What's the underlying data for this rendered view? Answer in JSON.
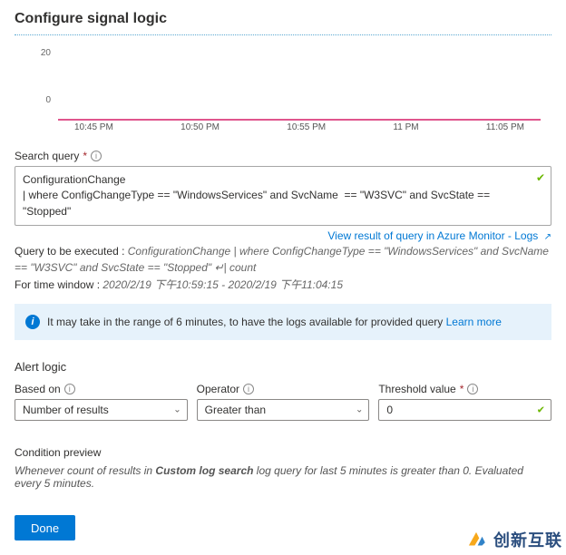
{
  "page": {
    "title": "Configure signal logic"
  },
  "chart_data": {
    "type": "line",
    "x": [
      "10:45 PM",
      "10:50 PM",
      "10:55 PM",
      "11 PM",
      "11:05 PM"
    ],
    "values": [
      0,
      0,
      0,
      0,
      0
    ],
    "y_ticks": [
      0,
      20
    ],
    "ylim": [
      0,
      20
    ],
    "title": "",
    "xlabel": "",
    "ylabel": ""
  },
  "search_query": {
    "label": "Search query",
    "required": true,
    "text": "ConfigurationChange\n| where ConfigChangeType == \"WindowsServices\" and SvcName  == \"W3SVC\" and SvcState == \"Stopped\"",
    "link_text": "View result of query in Azure Monitor - Logs",
    "exec_prefix": "Query to be executed : ",
    "exec_query": "ConfigurationChange | where ConfigChangeType == \"WindowsServices\" and SvcName == \"W3SVC\" and SvcState == \"Stopped\" ↵| count",
    "time_window_prefix": "For time window : ",
    "time_window": "2020/2/19 下午10:59:15 - 2020/2/19 下午11:04:15"
  },
  "info_banner": {
    "text": "It may take in the range of 6 minutes, to have the logs available for provided query",
    "link": "Learn more"
  },
  "alert_logic": {
    "heading": "Alert logic",
    "based_on": {
      "label": "Based on",
      "value": "Number of results"
    },
    "operator": {
      "label": "Operator",
      "value": "Greater than"
    },
    "threshold": {
      "label": "Threshold value",
      "required": true,
      "value": "0"
    }
  },
  "condition": {
    "heading": "Condition preview",
    "prefix": "Whenever count of results in ",
    "bold": "Custom log search",
    "suffix": " log query for last 5 minutes is greater than 0. Evaluated every 5 minutes."
  },
  "actions": {
    "done": "Done"
  },
  "brand": {
    "text": "创新互联"
  }
}
